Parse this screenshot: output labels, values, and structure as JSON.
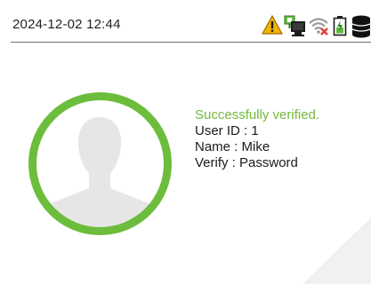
{
  "status_bar": {
    "datetime": "2024-12-02 12:44",
    "icons": [
      "warning-icon",
      "network-computer-icon",
      "wifi-disconnected-icon",
      "battery-charging-icon",
      "database-icon"
    ]
  },
  "verification": {
    "message": "Successfully verified.",
    "user_id": "User ID : 1",
    "name": "Name : Mike",
    "verify": "Verify :  Password"
  },
  "colors": {
    "success": "#72b93b",
    "avatar_ring": "#6cbd3c",
    "warning": "#f5b400",
    "alert_red": "#e53935"
  }
}
